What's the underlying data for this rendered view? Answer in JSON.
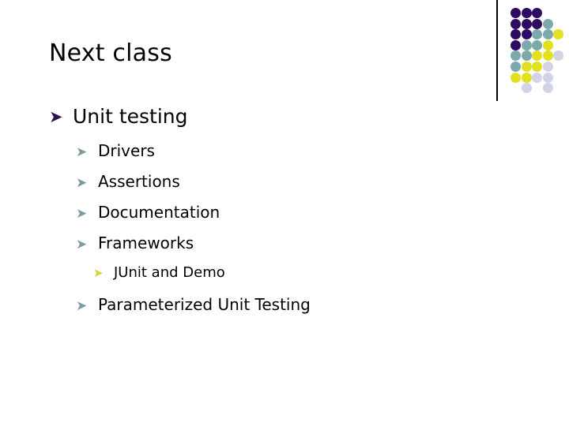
{
  "slide": {
    "title": "Next class",
    "background_color": "#ffffff",
    "text_color": "#000000"
  },
  "decoration": {
    "name": "dot-grid-ornament",
    "rule_color": "#000000",
    "palette": {
      "dark_purple": "#2e0a63",
      "teal": "#7ca9ab",
      "yellow": "#e3e022",
      "lavender": "#d3d3e8"
    },
    "rows": 8,
    "cols": 5,
    "cells": [
      [
        "dark_purple",
        "dark_purple",
        "dark_purple",
        "",
        ""
      ],
      [
        "dark_purple",
        "dark_purple",
        "dark_purple",
        "teal",
        ""
      ],
      [
        "dark_purple",
        "dark_purple",
        "teal",
        "teal",
        "yellow"
      ],
      [
        "dark_purple",
        "teal",
        "teal",
        "yellow",
        ""
      ],
      [
        "teal",
        "teal",
        "yellow",
        "yellow",
        "lavender"
      ],
      [
        "teal",
        "yellow",
        "yellow",
        "lavender",
        ""
      ],
      [
        "yellow",
        "yellow",
        "lavender",
        "lavender",
        ""
      ],
      [
        "",
        "lavender",
        "",
        "lavender",
        ""
      ]
    ]
  },
  "bullets": {
    "marker_glyph": "➤",
    "level_colors": {
      "level1": "#2a1259",
      "level2": "#7e9ba3",
      "level3": "#d4d13a"
    },
    "items": [
      {
        "level": 1,
        "text": "Unit testing"
      },
      {
        "level": 2,
        "text": "Drivers"
      },
      {
        "level": 2,
        "text": "Assertions"
      },
      {
        "level": 2,
        "text": "Documentation"
      },
      {
        "level": 2,
        "text": "Frameworks"
      },
      {
        "level": 3,
        "text": "JUnit and Demo"
      },
      {
        "level": 2,
        "text": "Parameterized Unit Testing"
      }
    ]
  }
}
